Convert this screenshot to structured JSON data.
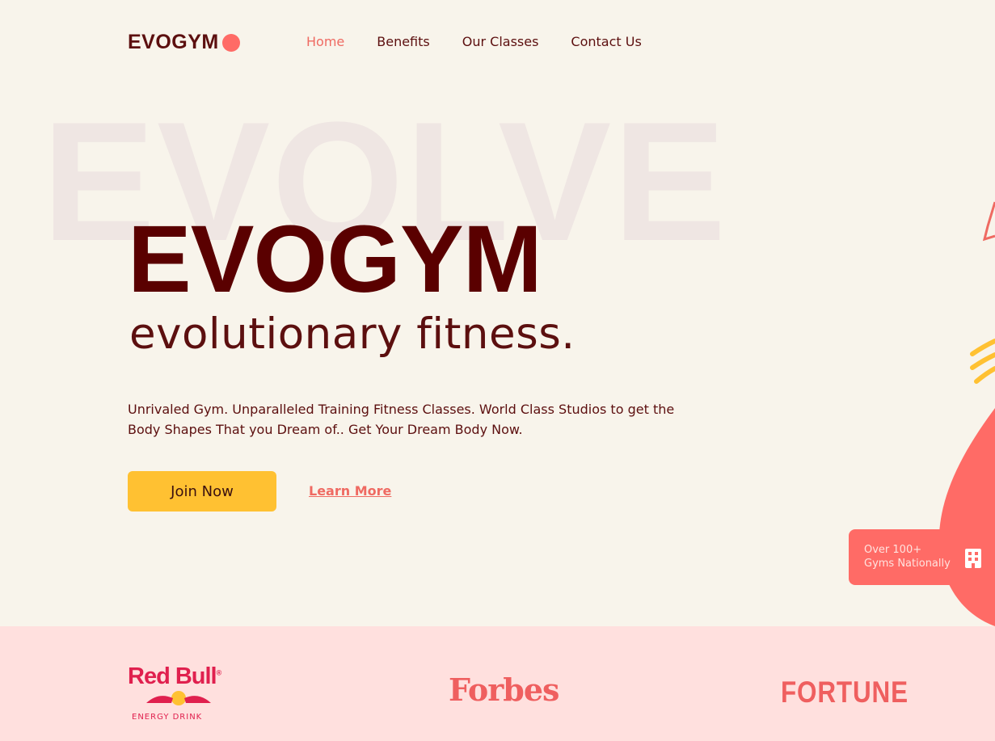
{
  "nav": {
    "logo_text": "EVOGYM",
    "links": [
      {
        "label": "Home",
        "active": true
      },
      {
        "label": "Benefits",
        "active": false
      },
      {
        "label": "Our Classes",
        "active": false
      },
      {
        "label": "Contact Us",
        "active": false
      }
    ]
  },
  "hero": {
    "background_word": "EVOLVE",
    "title": "EVOGYM",
    "subtitle": "evolutionary fitness.",
    "description": "Unrivaled Gym. Unparalleled Training Fitness Classes. World Class Studios to get the Body Shapes That you Dream of.. Get Your Dream Body Now.",
    "join_button": "Join Now",
    "learn_more": "Learn More"
  },
  "stat_card": {
    "line1": "Over 100+",
    "line2": "Gyms Nationally",
    "icon": "building-icon"
  },
  "sponsors": {
    "redbull": "Red Bull",
    "redbull_tag": "ENERGY DRINK",
    "forbes": "Forbes",
    "fortune": "FORTUNE"
  },
  "colors": {
    "background": "#f8f4eb",
    "primary_dark": "#5c0f0f",
    "accent_coral": "#ff6b66",
    "accent_yellow": "#ffc132",
    "sponsor_bg": "#ffe0de"
  }
}
